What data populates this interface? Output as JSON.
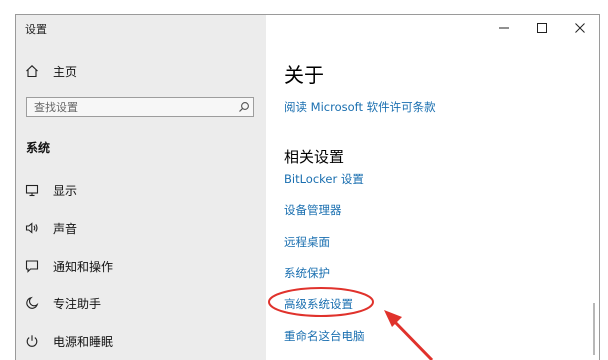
{
  "window": {
    "title": "设置"
  },
  "sidebar": {
    "home_label": "主页",
    "search_placeholder": "查找设置",
    "section_label": "系统",
    "items": [
      {
        "label": "显示",
        "icon": "monitor-icon"
      },
      {
        "label": "声音",
        "icon": "speaker-icon"
      },
      {
        "label": "通知和操作",
        "icon": "notification-icon"
      },
      {
        "label": "专注助手",
        "icon": "moon-icon"
      },
      {
        "label": "电源和睡眠",
        "icon": "power-icon"
      }
    ]
  },
  "main": {
    "title": "关于",
    "license_link": "阅读 Microsoft 软件许可条款",
    "related_heading": "相关设置",
    "related_links": [
      {
        "label": "BitLocker 设置"
      },
      {
        "label": "设备管理器"
      },
      {
        "label": "远程桌面"
      },
      {
        "label": "系统保护"
      },
      {
        "label": "高级系统设置",
        "highlighted": true
      },
      {
        "label": "重命名这台电脑"
      }
    ]
  },
  "colors": {
    "link": "#1a6fb0",
    "annotation": "#e0322c",
    "sidebar_bg": "#ececec"
  }
}
